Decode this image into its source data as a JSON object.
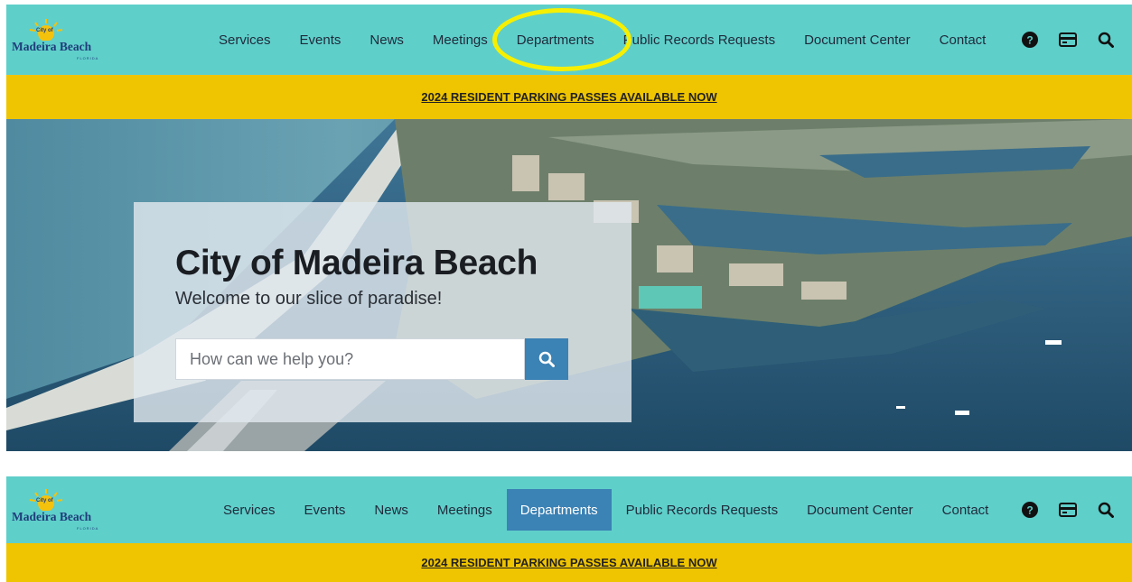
{
  "top": {
    "logo": {
      "line1": "Madeira Beach",
      "tag": "City of",
      "sub": "FLORIDA"
    },
    "menu": [
      {
        "label": "Services"
      },
      {
        "label": "Events"
      },
      {
        "label": "News"
      },
      {
        "label": "Meetings"
      },
      {
        "label": "Departments"
      },
      {
        "label": "Public Records Requests"
      },
      {
        "label": "Document Center"
      },
      {
        "label": "Contact"
      }
    ],
    "icons": [
      "help-icon",
      "payment-card-icon",
      "search-icon"
    ],
    "banner": "2024 RESIDENT PARKING PASSES AVAILABLE NOW",
    "hero": {
      "title": "City of Madeira Beach",
      "subtitle": "Welcome to our slice of paradise!",
      "search_placeholder": "How can we help you?"
    }
  },
  "bottom": {
    "logo": {
      "line1": "Madeira Beach",
      "tag": "City of",
      "sub": "FLORIDA"
    },
    "menu": [
      {
        "label": "Services"
      },
      {
        "label": "Events"
      },
      {
        "label": "News"
      },
      {
        "label": "Meetings"
      },
      {
        "label": "Departments",
        "active": true
      },
      {
        "label": "Public Records Requests"
      },
      {
        "label": "Document Center"
      },
      {
        "label": "Contact"
      }
    ],
    "banner": "2024 RESIDENT PARKING PASSES AVAILABLE NOW"
  },
  "colors": {
    "nav_bg": "#5fcfca",
    "banner_bg": "#efc400",
    "accent": "#3b82b5",
    "annotation": "#f6ef00"
  }
}
